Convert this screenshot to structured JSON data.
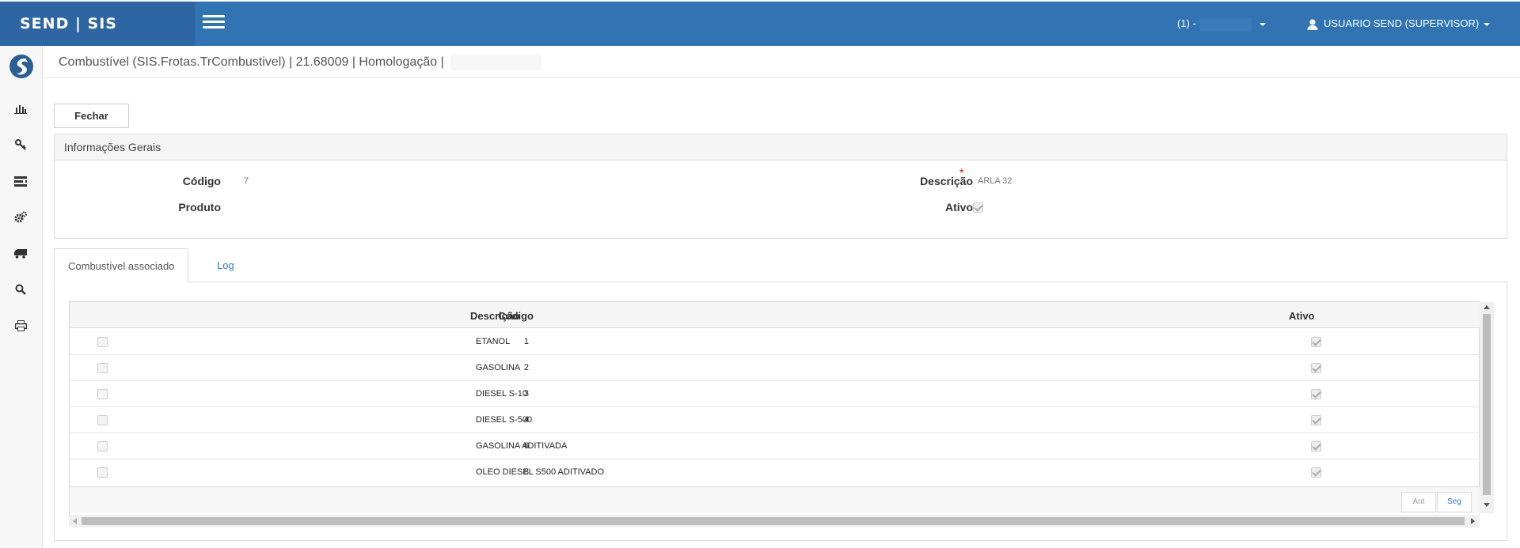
{
  "topbar": {
    "brand": "SEND | SIS",
    "company_label": "(1) -",
    "user_label": "USUARIO SEND (SUPERVISOR)"
  },
  "page": {
    "title": "Combustível (SIS.Frotas.TrCombustivel) | 21.68009 | Homologação |"
  },
  "actions": {
    "close_label": "Fechar"
  },
  "general_info": {
    "heading": "Informações Gerais",
    "codigo_label": "Código",
    "codigo_value": "7",
    "produto_label": "Produto",
    "descricao_label": "Descrição",
    "descricao_value": "ARLA 32",
    "required_mark": "*",
    "ativo_label": "Ativo",
    "ativo_checked": true
  },
  "tabs": [
    {
      "label": "Combustível associado",
      "active": true
    },
    {
      "label": "Log",
      "active": false
    }
  ],
  "grid": {
    "columns": [
      "Código",
      "Descrição",
      "Ativo"
    ],
    "rows": [
      {
        "codigo": "1",
        "descricao": "ETANOL",
        "ativo": true
      },
      {
        "codigo": "2",
        "descricao": "GASOLINA",
        "ativo": true
      },
      {
        "codigo": "3",
        "descricao": "DIESEL S-10",
        "ativo": true
      },
      {
        "codigo": "4",
        "descricao": "DIESEL S-500",
        "ativo": true
      },
      {
        "codigo": "6",
        "descricao": "GASOLINA ADITIVADA",
        "ativo": true
      },
      {
        "codigo": "8",
        "descricao": "OLEO DIESEL S500 ADITIVADO",
        "ativo": true
      }
    ],
    "pager": {
      "prev_label": "Ant",
      "next_label": "Seg"
    }
  },
  "colors": {
    "topbar": "#3173b3",
    "brand_bg": "#2d66a2",
    "link": "#337ab7",
    "required": "#ee0000"
  },
  "sidebar_icons": [
    "logo-icon",
    "chart-icon",
    "key-icon",
    "list-icon",
    "cogs-icon",
    "truck-icon",
    "search-icon",
    "print-icon"
  ]
}
